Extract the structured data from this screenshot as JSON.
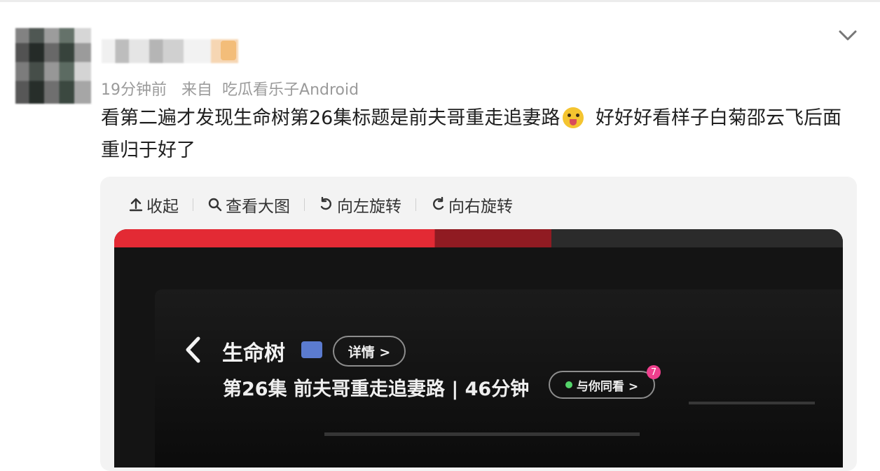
{
  "post": {
    "meta": {
      "time": "19分钟前",
      "source_prefix": "来自",
      "source": "吃瓜看乐子Android"
    },
    "content_before": "看第二遍才发现生命树第26集标题是前夫哥重走追妻路",
    "content_after": " 好好好看样子白菊邵云飞后面重归于好了"
  },
  "toolbar": {
    "collapse": "收起",
    "view_large": "查看大图",
    "rotate_left": "向左旋转",
    "rotate_right": "向右旋转"
  },
  "photo": {
    "title": "生命树",
    "detail": "详情 >",
    "episode": "第26集 前夫哥重走追妻路 | 46分钟",
    "watch_together": "与你同看 >",
    "count": "7"
  },
  "colors": {
    "meta": "#9a9a9a",
    "text": "#1f1f1f",
    "card_bg": "#f3f3f3",
    "accent": "#ef3f8d"
  },
  "icons": {
    "collapse": "upload-arrow-icon",
    "search": "search-icon",
    "rotate_left": "rotate-left-icon",
    "rotate_right": "rotate-right-icon",
    "menu": "chevron-down-icon"
  }
}
